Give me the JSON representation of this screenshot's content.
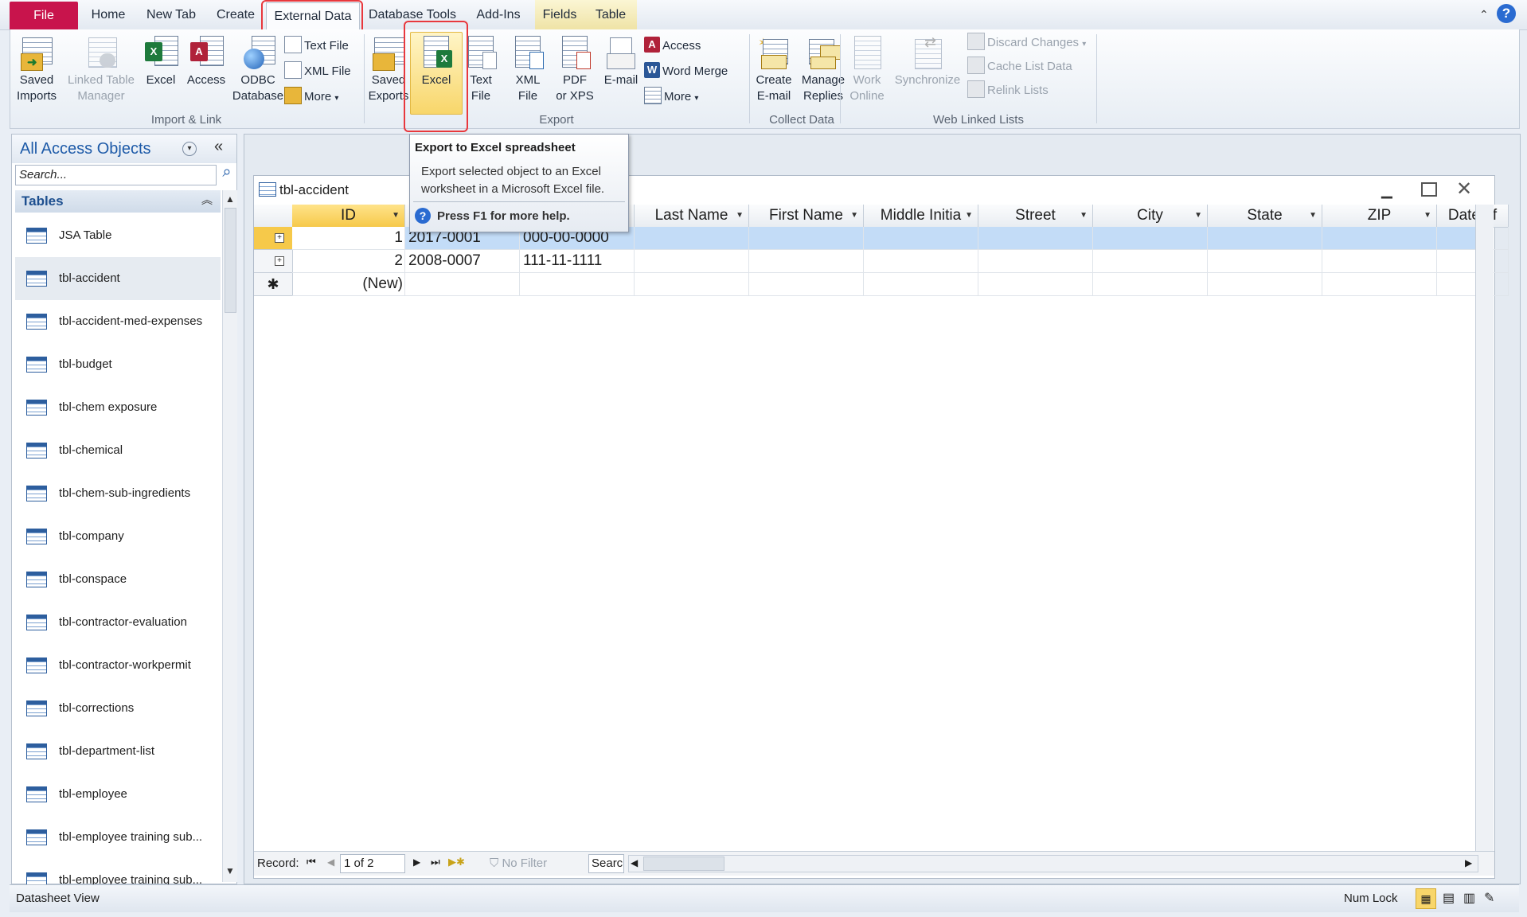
{
  "tabs": {
    "file": "File",
    "home": "Home",
    "new_tab": "New Tab",
    "create": "Create",
    "external_data": "External Data",
    "database_tools": "Database Tools",
    "add_ins": "Add-Ins",
    "fields": "Fields",
    "table": "Table"
  },
  "ribbon": {
    "import_link": {
      "label": "Import & Link",
      "saved_imports": [
        "Saved",
        "Imports"
      ],
      "linked_table_manager": [
        "Linked Table",
        "Manager"
      ],
      "excel": "Excel",
      "access": "Access",
      "odbc": [
        "ODBC",
        "Database"
      ],
      "text_file": "Text File",
      "xml_file": "XML File",
      "more": "More"
    },
    "export": {
      "label": "Export",
      "saved_exports": [
        "Saved",
        "Exports"
      ],
      "excel": "Excel",
      "text_file": [
        "Text",
        "File"
      ],
      "xml_file": [
        "XML",
        "File"
      ],
      "pdf": [
        "PDF",
        "or XPS"
      ],
      "email": "E-mail",
      "access": "Access",
      "word_merge": "Word Merge",
      "more": "More"
    },
    "collect": {
      "label": "Collect Data",
      "create_email": [
        "Create",
        "E-mail"
      ],
      "manage_replies": [
        "Manage",
        "Replies"
      ]
    },
    "web": {
      "label": "Web Linked Lists",
      "work_online": [
        "Work",
        "Online"
      ],
      "synchronize": "Synchronize",
      "discard_changes": "Discard Changes",
      "cache_list_data": "Cache List Data",
      "relink_lists": "Relink Lists"
    }
  },
  "tooltip": {
    "title": "Export to Excel spreadsheet",
    "body1": "Export selected object to an Excel",
    "body2": "worksheet in a Microsoft Excel file.",
    "help": "Press F1 for more help."
  },
  "nav": {
    "title": "All Access Objects",
    "search_placeholder": "Search...",
    "section": "Tables",
    "items": [
      "JSA Table",
      "tbl-accident",
      "tbl-accident-med-expenses",
      "tbl-budget",
      "tbl-chem exposure",
      "tbl-chemical",
      "tbl-chem-sub-ingredients",
      "tbl-company",
      "tbl-conspace",
      "tbl-contractor-evaluation",
      "tbl-contractor-workpermit",
      "tbl-corrections",
      "tbl-department-list",
      "tbl-employee",
      "tbl-employee training sub...",
      "tbl-employee training sub..."
    ]
  },
  "document": {
    "title": "tbl-accident",
    "columns": [
      "ID",
      "",
      "",
      "Last Name",
      "First Name",
      "Middle Initia",
      "Street",
      "City",
      "State",
      "ZIP",
      "Date of"
    ],
    "rows": [
      {
        "id": "1",
        "c2": "2017-0001",
        "c3": "000-00-0000"
      },
      {
        "id": "2",
        "c2": "2008-0007",
        "c3": "111-11-1111"
      }
    ],
    "new_row": "(New)"
  },
  "record_nav": {
    "label": "Record:",
    "position": "1 of 2",
    "filter": "No Filter",
    "search": "Search"
  },
  "status": {
    "view": "Datasheet View",
    "num_lock": "Num Lock"
  }
}
